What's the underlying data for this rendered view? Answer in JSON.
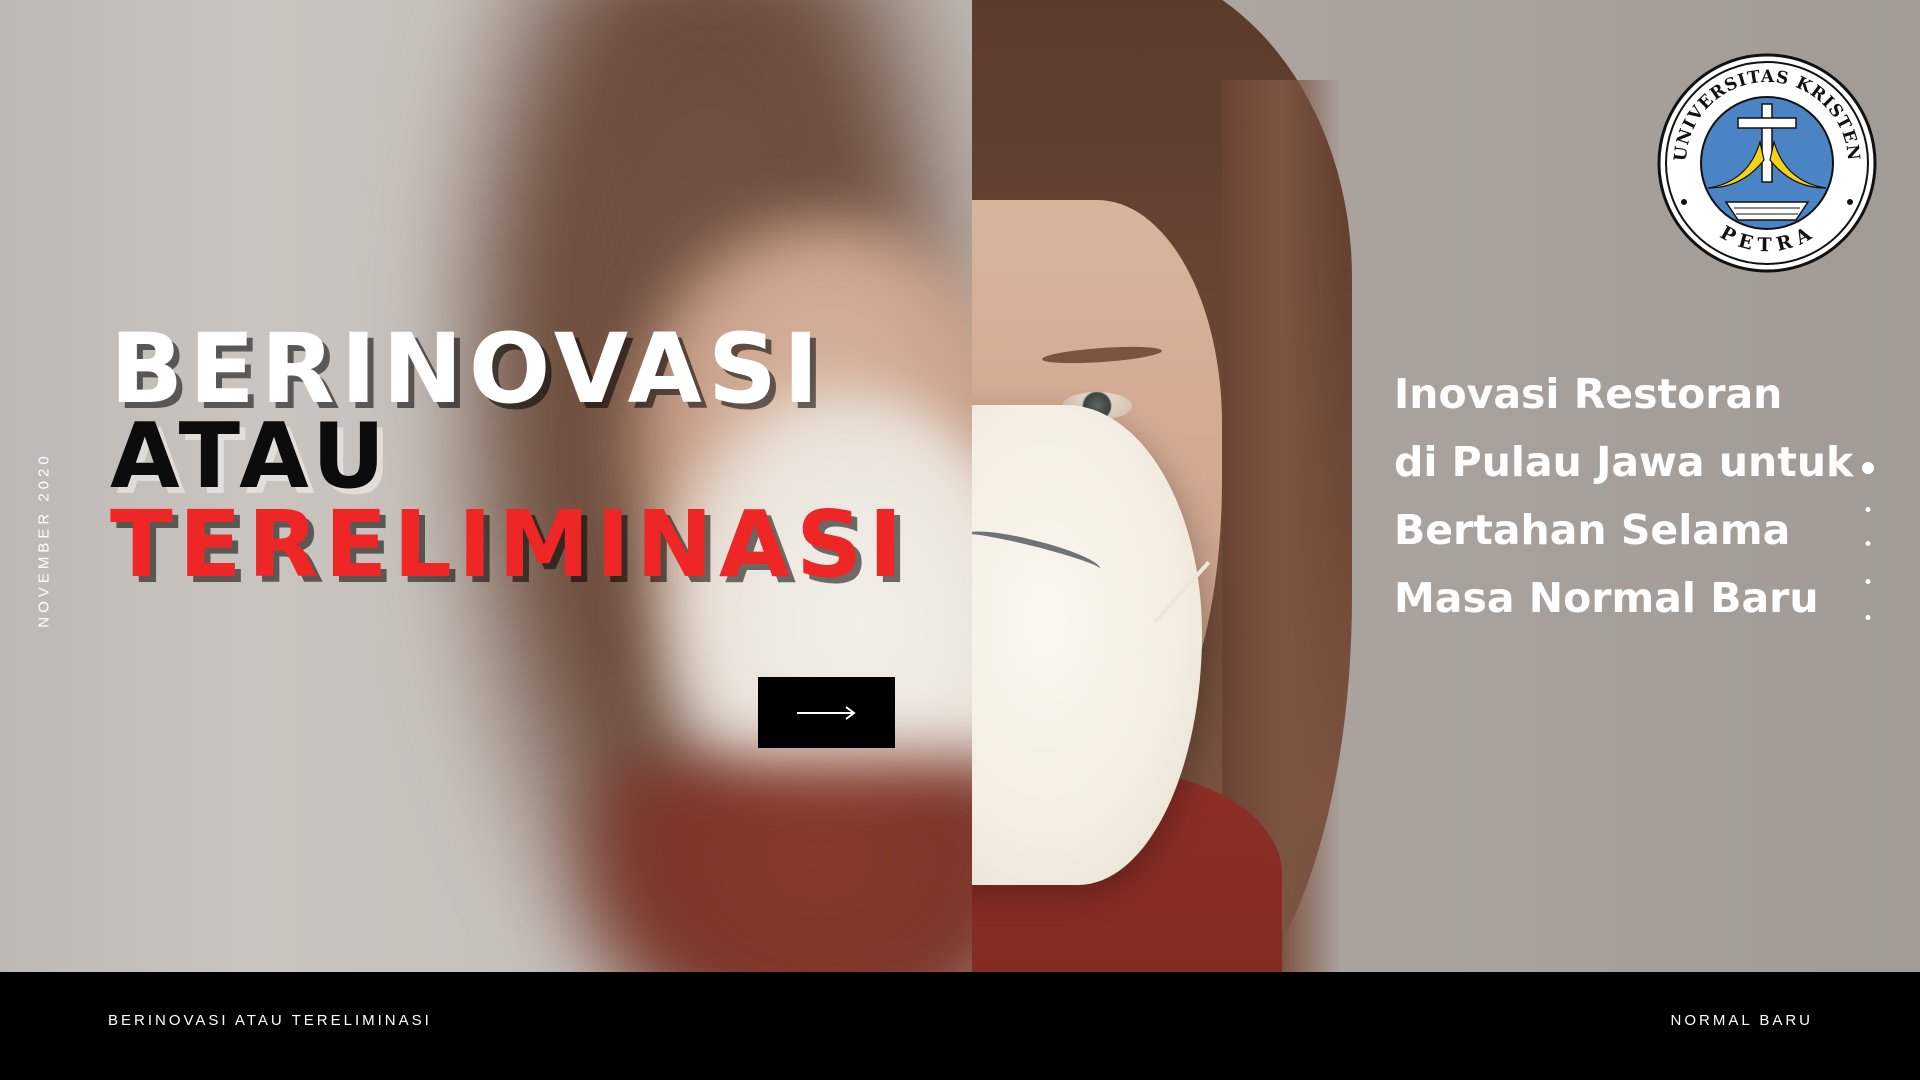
{
  "slide": {
    "date_label": "NOVEMBER 2020",
    "headline": {
      "line1": "BERINOVASI",
      "line2": "ATAU",
      "line3": "TERELIMINASI"
    },
    "subtitle": {
      "line1": "Inovasi Restoran",
      "line2": "di Pulau Jawa untuk",
      "line3": "Bertahan Selama",
      "line4": "Masa Normal Baru"
    },
    "next_button_icon": "right-arrow-icon",
    "pagination": {
      "total": 5,
      "active_index": 0
    }
  },
  "logo": {
    "text_top": "UNIVERSITAS KRISTEN",
    "text_bottom": "PETRA",
    "colors": {
      "field": "#4a84c4",
      "ring": "#ffffff",
      "accent": "#f2d21a",
      "outline": "#111111"
    }
  },
  "footer": {
    "left_label": "BERINOVASI ATAU TERELIMINASI",
    "right_label": "NORMAL BARU"
  },
  "colors": {
    "headline_white": "#ffffff",
    "headline_black": "#0c0c0c",
    "headline_red": "#ee2626",
    "footer_bg": "#000000"
  }
}
